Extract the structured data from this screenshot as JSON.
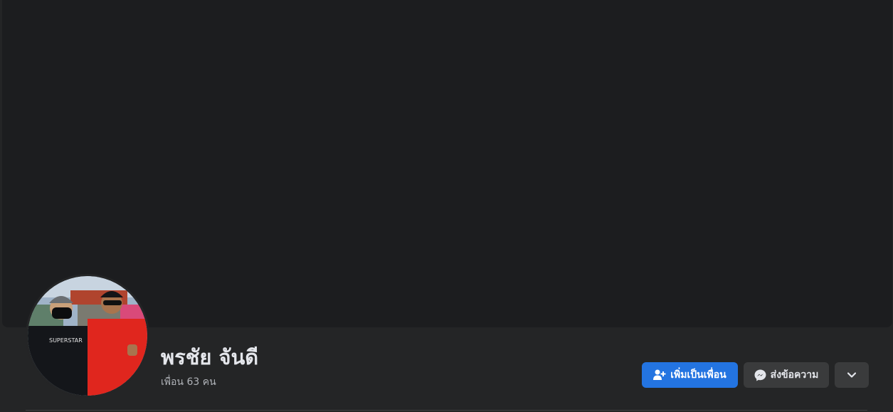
{
  "profile": {
    "name": "พรชัย จันดี",
    "friends_text": "เพื่อน 63 คน",
    "avatar_shirt_text": "SUPERSTAR"
  },
  "actions": {
    "add_friend_label": "เพิ่มเป็นเพื่อน",
    "message_label": "ส่งข้อความ",
    "more_icon": "chevron-down-icon",
    "add_friend_icon": "user-plus-icon",
    "message_icon": "messenger-icon"
  },
  "colors": {
    "primary": "#2374e1",
    "surface": "#242526",
    "cover": "#1c1d1f",
    "secondary_button": "#3a3b3c"
  }
}
